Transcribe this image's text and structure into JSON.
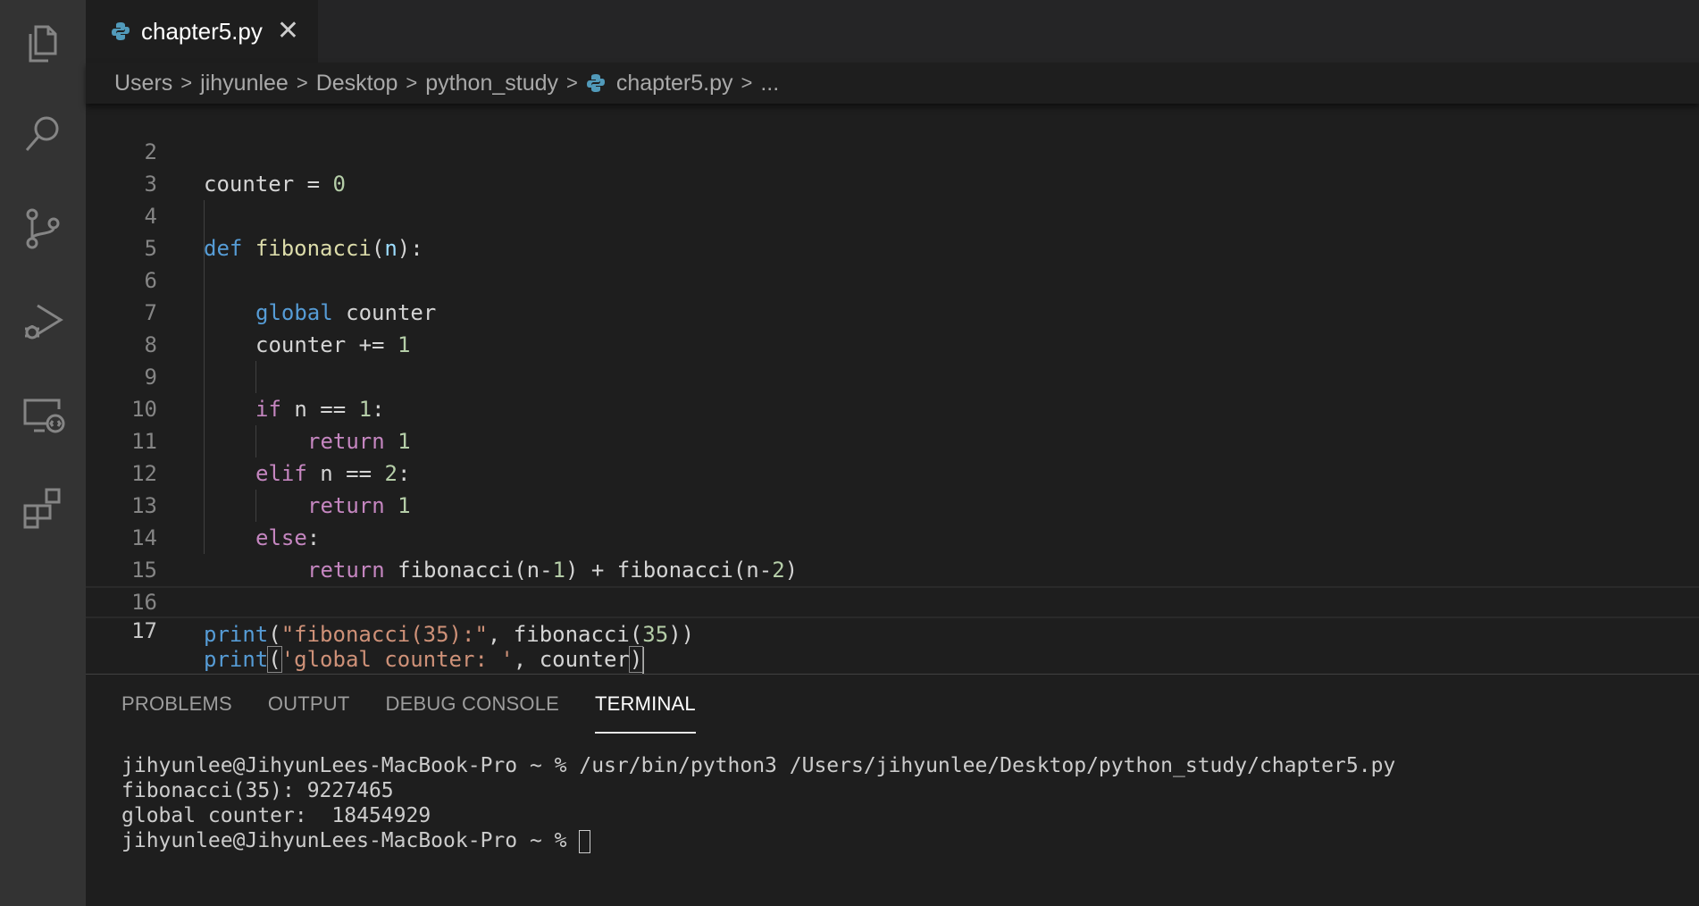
{
  "activity_bar": {
    "icons": [
      "explorer-icon",
      "search-icon",
      "source-control-icon",
      "run-debug-icon",
      "remote-explorer-icon",
      "extensions-icon"
    ]
  },
  "tab": {
    "label": "chapter5.py",
    "close": "✕"
  },
  "breadcrumb": {
    "items": [
      "Users",
      "jihyunlee",
      "Desktop",
      "python_study",
      "chapter5.py",
      "..."
    ],
    "separator": ">"
  },
  "editor": {
    "lines": [
      {
        "n": "2"
      },
      {
        "n": "3"
      },
      {
        "n": "4"
      },
      {
        "n": "5"
      },
      {
        "n": "6"
      },
      {
        "n": "7"
      },
      {
        "n": "8"
      },
      {
        "n": "9"
      },
      {
        "n": "10"
      },
      {
        "n": "11"
      },
      {
        "n": "12"
      },
      {
        "n": "13"
      },
      {
        "n": "14"
      },
      {
        "n": "15"
      },
      {
        "n": "16"
      },
      {
        "n": "17"
      }
    ],
    "tokens": {
      "l2": [
        "counter",
        " = ",
        "0"
      ],
      "l4": [
        "def",
        " ",
        "fibonacci",
        "(",
        "n",
        "):"
      ],
      "l6": [
        "global",
        " counter"
      ],
      "l7": [
        "counter",
        " += ",
        "1"
      ],
      "l9": [
        "if",
        " n == ",
        "1",
        ":"
      ],
      "l10": [
        "return",
        " ",
        "1"
      ],
      "l11": [
        "elif",
        " n == ",
        "2",
        ":"
      ],
      "l12": [
        "return",
        " ",
        "1"
      ],
      "l13": [
        "else",
        ":"
      ],
      "l14": [
        "return",
        " fibonacci(n-",
        "1",
        ") + fibonacci(n-",
        "2",
        ")"
      ],
      "l16": [
        "print",
        "(",
        "\"fibonacci(35):\"",
        ", fibonacci(",
        "35",
        "))"
      ],
      "l17": [
        "print",
        "(",
        "'global counter: '",
        ", counter",
        ")"
      ]
    }
  },
  "panel": {
    "tabs": [
      "PROBLEMS",
      "OUTPUT",
      "DEBUG CONSOLE",
      "TERMINAL"
    ],
    "active_tab": "TERMINAL",
    "terminal_lines": [
      "jihyunlee@JihyunLees-MacBook-Pro ~ % /usr/bin/python3 /Users/jihyunlee/Desktop/python_study/chapter5.py",
      "fibonacci(35): 9227465",
      "global counter:  18454929",
      "jihyunlee@JihyunLees-MacBook-Pro ~ % "
    ]
  },
  "colors": {
    "keyword_blue": "#569cd6",
    "keyword_control": "#c586c0",
    "function": "#dcdcaa",
    "number": "#b5cea8",
    "string": "#ce9178"
  }
}
